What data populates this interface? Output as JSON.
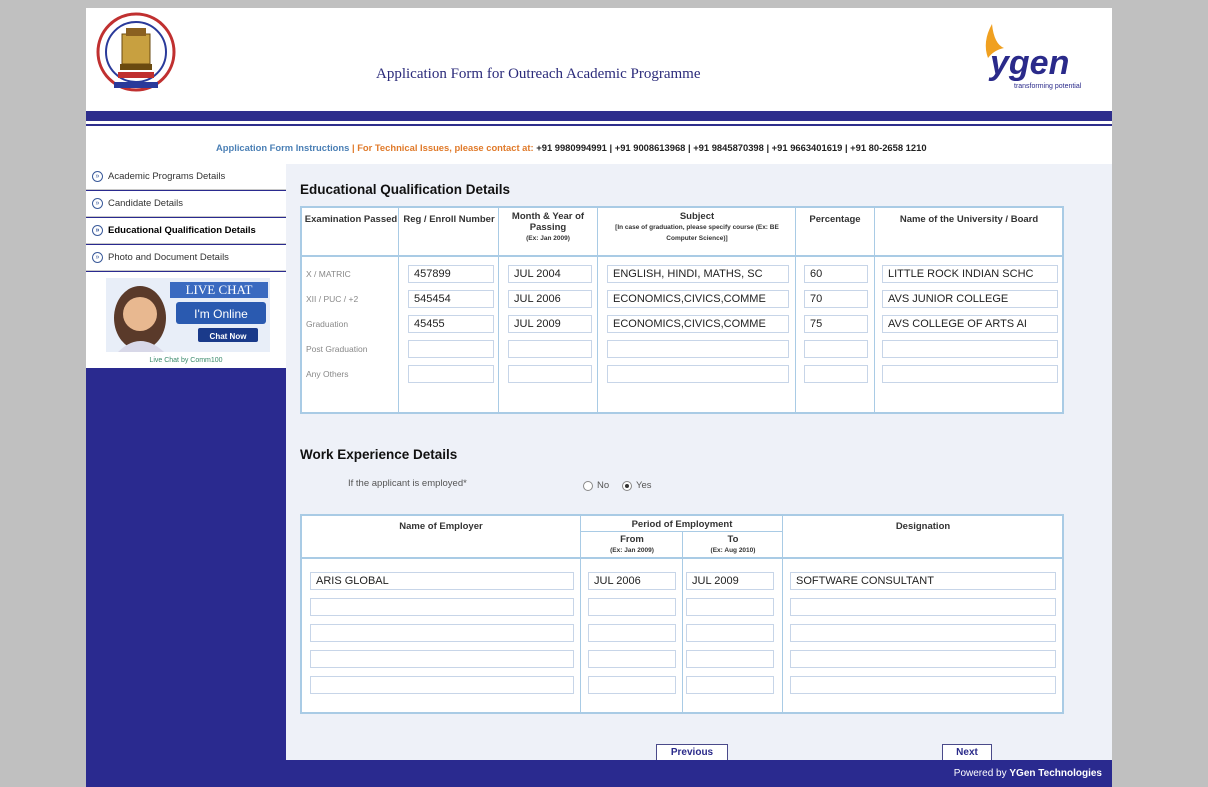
{
  "header": {
    "title": "Application Form for Outreach Academic Programme",
    "right_logo_text": "ygen",
    "right_logo_tagline": "transforming potential"
  },
  "instructions": {
    "link": "Application Form Instructions",
    "separator": " | ",
    "tech_issues": "For Technical Issues, please contact at:",
    "phones": "+91 9980994991 | +91 9008613968 | +91 9845870398 | +91 9663401619 | +91 80-2658 1210"
  },
  "sidebar": {
    "items": [
      {
        "label": "Academic Programs Details"
      },
      {
        "label": "Candidate Details"
      },
      {
        "label": "Educational Qualification Details"
      },
      {
        "label": "Photo and Document Details"
      }
    ],
    "chat": {
      "title": "LIVE CHAT",
      "status": "I'm Online",
      "button": "Chat Now",
      "powered": "Live Chat by Comm100"
    }
  },
  "education": {
    "heading": "Educational Qualification Details",
    "columns": {
      "exam": "Examination Passed",
      "reg": "Reg / Enroll Number",
      "month": "Month & Year of Passing",
      "month_hint": "(Ex: Jan 2009)",
      "subject": "Subject",
      "subject_hint": "[In case of graduation, please specify course (Ex: BE Computer Science)]",
      "percentage": "Percentage",
      "university": "Name of the University / Board"
    },
    "rows": [
      {
        "label": "X / MATRIC",
        "reg": "457899",
        "month": "JUL 2004",
        "subject": "ENGLISH, HINDI, MATHS, SC",
        "percentage": "60",
        "university": "LITTLE ROCK INDIAN SCHC"
      },
      {
        "label": "XII / PUC / +2",
        "reg": "545454",
        "month": "JUL 2006",
        "subject": "ECONOMICS,CIVICS,COMME",
        "percentage": "70",
        "university": "AVS JUNIOR COLLEGE"
      },
      {
        "label": "Graduation",
        "reg": "45455",
        "month": "JUL 2009",
        "subject": "ECONOMICS,CIVICS,COMME",
        "percentage": "75",
        "university": "AVS COLLEGE OF ARTS AI"
      },
      {
        "label": "Post Graduation",
        "reg": "",
        "month": "",
        "subject": "",
        "percentage": "",
        "university": ""
      },
      {
        "label": "Any Others",
        "reg": "",
        "month": "",
        "subject": "",
        "percentage": "",
        "university": ""
      }
    ]
  },
  "work": {
    "heading": "Work Experience Details",
    "question": "If the applicant is employed*",
    "options": {
      "no": "No",
      "yes": "Yes"
    },
    "selected": "yes",
    "columns": {
      "employer": "Name of Employer",
      "period": "Period of Employment",
      "from": "From",
      "from_hint": "(Ex: Jan 2009)",
      "to": "To",
      "to_hint": "(Ex: Aug 2010)",
      "designation": "Designation"
    },
    "rows": [
      {
        "employer": "ARIS GLOBAL",
        "from": "JUL 2006",
        "to": "JUL 2009",
        "designation": "SOFTWARE CONSULTANT"
      },
      {
        "employer": "",
        "from": "",
        "to": "",
        "designation": ""
      },
      {
        "employer": "",
        "from": "",
        "to": "",
        "designation": ""
      },
      {
        "employer": "",
        "from": "",
        "to": "",
        "designation": ""
      },
      {
        "employer": "",
        "from": "",
        "to": "",
        "designation": ""
      }
    ]
  },
  "nav": {
    "previous": "Previous",
    "next": "Next"
  },
  "footer": {
    "powered_prefix": "Powered by",
    "powered_brand": "YGen Technologies"
  }
}
